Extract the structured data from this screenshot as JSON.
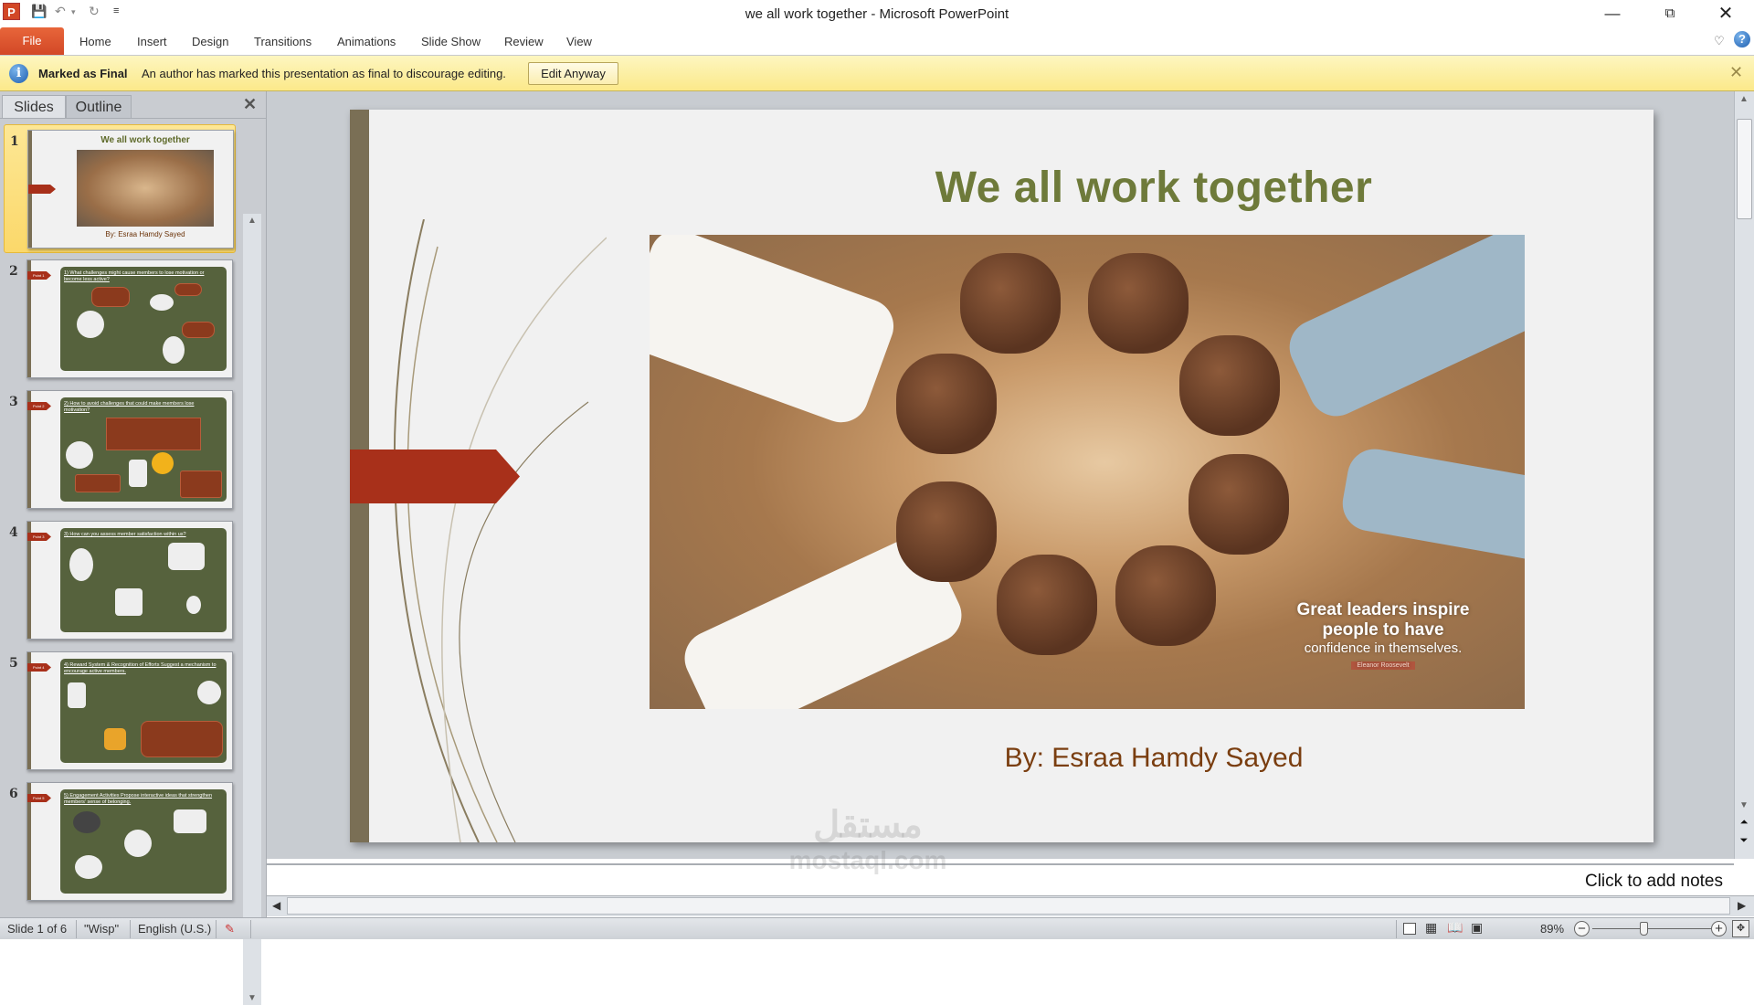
{
  "window": {
    "title": "we all work together  -  Microsoft PowerPoint",
    "app_icon": "P",
    "quick_access": [
      "save-icon",
      "undo-icon",
      "redo-icon",
      "customize-icon"
    ]
  },
  "ribbon": {
    "file_label": "File",
    "tabs": [
      "Home",
      "Insert",
      "Design",
      "Transitions",
      "Animations",
      "Slide Show",
      "Review",
      "View"
    ]
  },
  "message_bar": {
    "title": "Marked as Final",
    "message": "An author has marked this presentation as final to discourage editing.",
    "button": "Edit Anyway"
  },
  "left_panel": {
    "tabs": [
      "Slides",
      "Outline"
    ],
    "selected_tab": "Slides",
    "thumbnails": [
      {
        "number": "1",
        "title": "We all work together",
        "byline": "By: Esraa Hamdy Sayed"
      },
      {
        "number": "2",
        "tag": "Point 1",
        "title": "1) What challenges might cause members to lose motivation or become less active?"
      },
      {
        "number": "3",
        "tag": "Point 2",
        "title": "2) How to avoid challenges that could make members lose motivation?"
      },
      {
        "number": "4",
        "tag": "Point 3",
        "title": "3) How can you assess member satisfaction within us?"
      },
      {
        "number": "5",
        "tag": "Point 4",
        "title": "4) Reward System & Recognition of Efforts Suggest a mechanism to encourage active members."
      },
      {
        "number": "6",
        "tag": "Point 5",
        "title": "5) Engagement Activities Propose interactive ideas that strengthen members' sense of belonging."
      }
    ]
  },
  "slide": {
    "title": "We all work together",
    "byline": "By: Esraa Hamdy Sayed",
    "quote": {
      "line1": "Great leaders inspire",
      "line2": "people to have",
      "line3": "confidence in themselves.",
      "author": "Eleanor Roosevelt"
    }
  },
  "notes": {
    "placeholder": "Click to add notes"
  },
  "watermark": "مستقل\nmostaql.com",
  "status": {
    "slide_info": "Slide 1 of 6",
    "theme": "\"Wisp\"",
    "language": "English (U.S.)",
    "zoom": "89%",
    "zoom_value": 89
  },
  "colors": {
    "title_green": "#6e7a3a",
    "byline_brown": "#7a3e10",
    "accent_red": "#a8301a",
    "file_tab": "#d24726",
    "message_bar": "#fce98a"
  }
}
